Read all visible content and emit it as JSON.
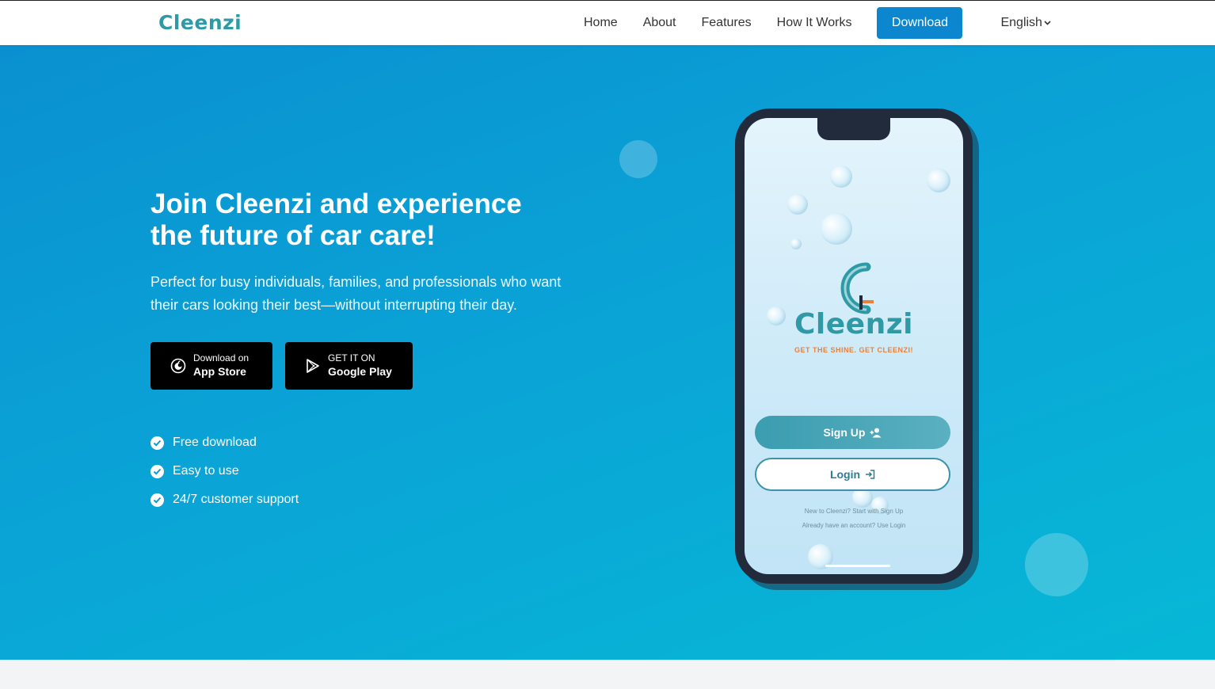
{
  "nav": {
    "logo": "Cleenzi",
    "links": [
      "Home",
      "About",
      "Features",
      "How It Works"
    ],
    "download": "Download",
    "language": "English",
    "language_icon": "chevron-down-icon"
  },
  "hero": {
    "title_line1": "Join Cleenzi and experience",
    "title_line2": "the future of car care!",
    "subtitle_line1": "Perfect for busy individuals, families, and professionals who want",
    "subtitle_line2": "their cars looking their best—without interrupting their day.",
    "app_store": {
      "small": "Download on",
      "big": "App Store",
      "icon": "apple-icon"
    },
    "google_play": {
      "small": "GET IT ON",
      "big": "Google Play",
      "icon": "play-store-icon"
    },
    "features": [
      "Free download",
      "Easy to use",
      "24/7 customer support"
    ],
    "feature_icon": "check-circle-icon"
  },
  "phone": {
    "app_name": "Cleenzi",
    "tagline": "GET THE SHINE. GET CLEENZI!",
    "signup": "Sign Up",
    "signup_icon": "user-plus-icon",
    "login": "Login",
    "login_icon": "sign-in-icon",
    "hint_signup": "New to Cleenzi? Start with Sign Up",
    "hint_login": "Already have an account? Use Login"
  },
  "colors": {
    "brand_teal": "#2f9aa6",
    "accent_orange": "#e9813a",
    "nav_button": "#0c87cf",
    "hero_gradient_start": "#0a90d0",
    "hero_gradient_end": "#07b8d6"
  }
}
